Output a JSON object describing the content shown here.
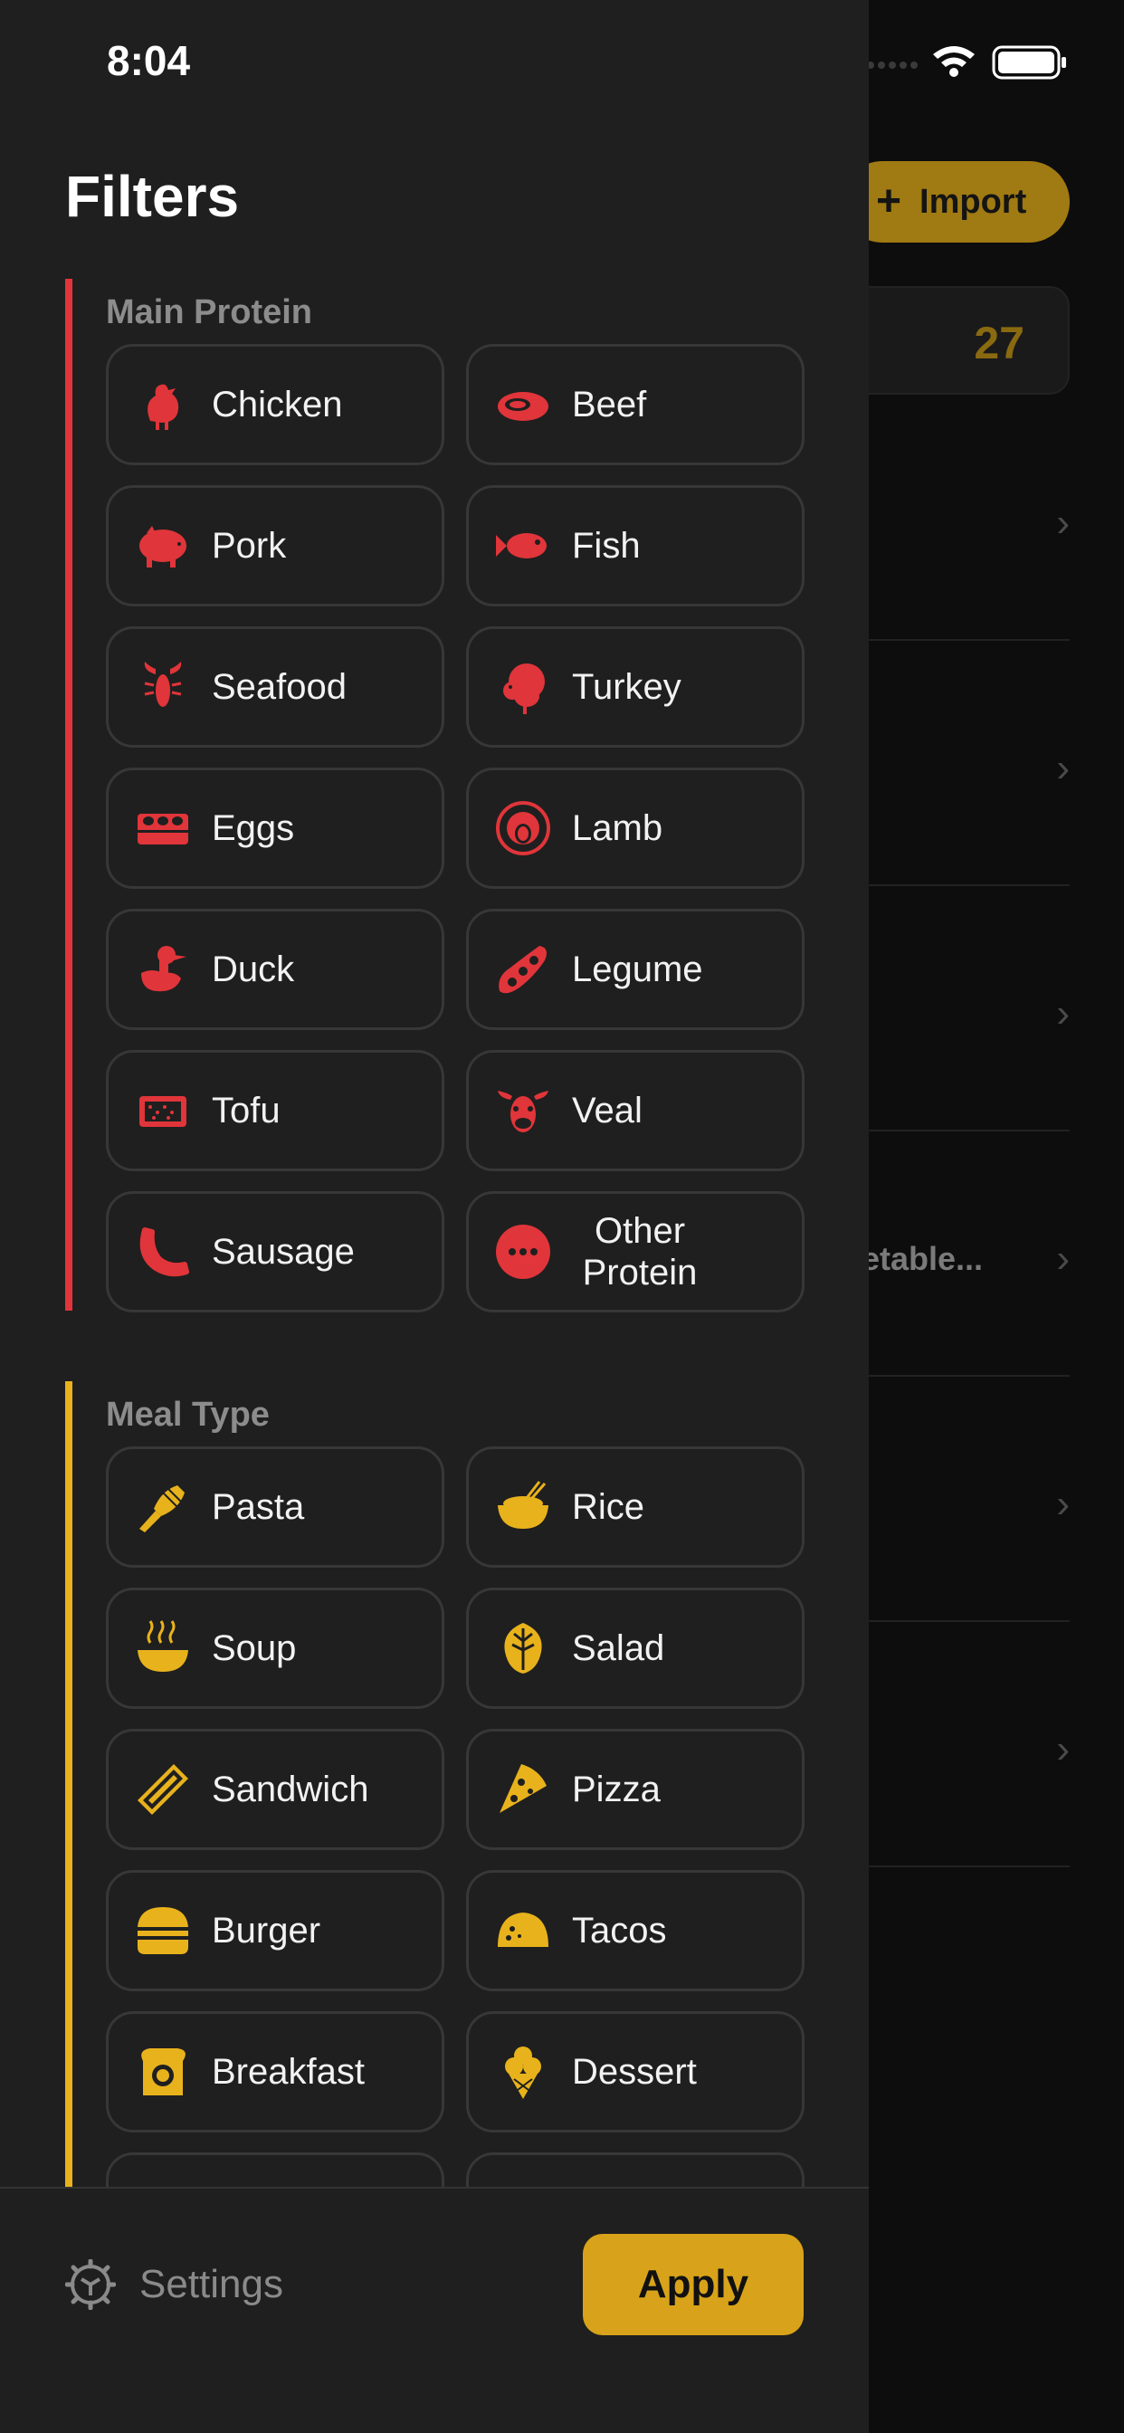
{
  "status_bar": {
    "time": "8:04"
  },
  "background": {
    "import_label": "Import",
    "count": "27",
    "partial_row_text": "getable..."
  },
  "drawer": {
    "title": "Filters",
    "sections": [
      {
        "label": "Main Protein",
        "color": "#e0353a",
        "items": [
          {
            "label": "Chicken",
            "icon": "chicken-icon"
          },
          {
            "label": "Beef",
            "icon": "steak-icon"
          },
          {
            "label": "Pork",
            "icon": "pig-icon"
          },
          {
            "label": "Fish",
            "icon": "fish-icon"
          },
          {
            "label": "Seafood",
            "icon": "lobster-icon"
          },
          {
            "label": "Turkey",
            "icon": "turkey-icon"
          },
          {
            "label": "Eggs",
            "icon": "egg-carton-icon"
          },
          {
            "label": "Lamb",
            "icon": "sheep-icon"
          },
          {
            "label": "Duck",
            "icon": "duck-icon"
          },
          {
            "label": "Legume",
            "icon": "bean-pod-icon"
          },
          {
            "label": "Tofu",
            "icon": "tofu-icon"
          },
          {
            "label": "Veal",
            "icon": "cow-icon"
          },
          {
            "label": "Sausage",
            "icon": "sausage-icon"
          },
          {
            "label": "Other Protein",
            "icon": "more-dots-icon"
          }
        ]
      },
      {
        "label": "Meal Type",
        "color": "#e8b21c",
        "items": [
          {
            "label": "Pasta",
            "icon": "pasta-icon"
          },
          {
            "label": "Rice",
            "icon": "rice-bowl-icon"
          },
          {
            "label": "Soup",
            "icon": "soup-icon"
          },
          {
            "label": "Salad",
            "icon": "salad-icon"
          },
          {
            "label": "Sandwich",
            "icon": "sandwich-icon"
          },
          {
            "label": "Pizza",
            "icon": "pizza-icon"
          },
          {
            "label": "Burger",
            "icon": "burger-icon"
          },
          {
            "label": "Tacos",
            "icon": "taco-icon"
          },
          {
            "label": "Breakfast",
            "icon": "toast-egg-icon"
          },
          {
            "label": "Dessert",
            "icon": "ice-cream-icon"
          }
        ]
      }
    ],
    "settings_label": "Settings",
    "apply_label": "Apply"
  }
}
